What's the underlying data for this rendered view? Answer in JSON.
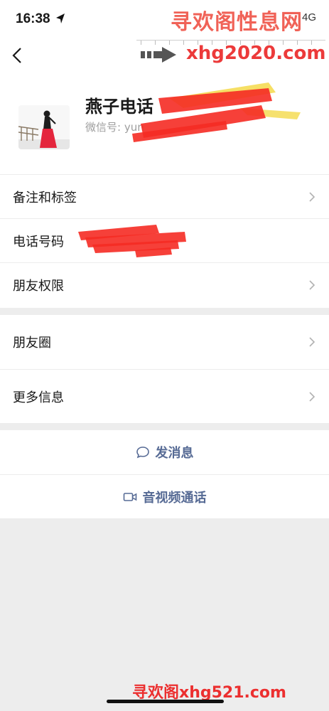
{
  "status_bar": {
    "time": "16:38",
    "network": "4G"
  },
  "watermark": {
    "top_text": "寻欢阁性息网",
    "url": "xhg2020.com",
    "bottom_text": "寻欢阁xhg521.com"
  },
  "profile": {
    "name": "燕子电话",
    "wechat_label": "微信号: yun"
  },
  "menu": {
    "remarks_tags": "备注和标签",
    "phone": "电话号码",
    "friend_permissions": "朋友权限",
    "moments": "朋友圈",
    "more_info": "更多信息"
  },
  "actions": {
    "send_message": "发消息",
    "av_call": "音视频通话"
  },
  "colors": {
    "accent": "#576b95",
    "redaction": "#f52b24",
    "background": "#ededed"
  }
}
